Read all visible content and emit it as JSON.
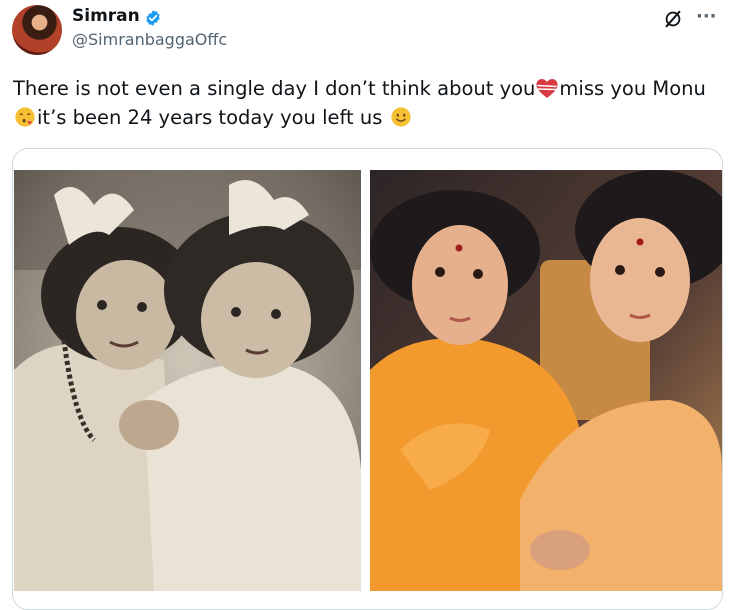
{
  "author": {
    "display_name": "Simran",
    "handle": "@SimranbaggaOffc"
  },
  "tweet": {
    "text_part1": "There is not even a single day I don’t think about you",
    "text_part2": "miss you Monu",
    "text_part3": "it’s been 24 years today you left us"
  },
  "icons": {
    "verified": "verified-badge-icon",
    "grok": "grok-icon",
    "more": "more-options-icon",
    "emoji1": "broken-heart-emoji",
    "emoji2": "kissing-face-emoji",
    "emoji3": "smiling-face-emoji"
  },
  "colors": {
    "verified_blue": "#1d9bf0",
    "secondary_text": "#536471",
    "border": "#cfd9de"
  }
}
